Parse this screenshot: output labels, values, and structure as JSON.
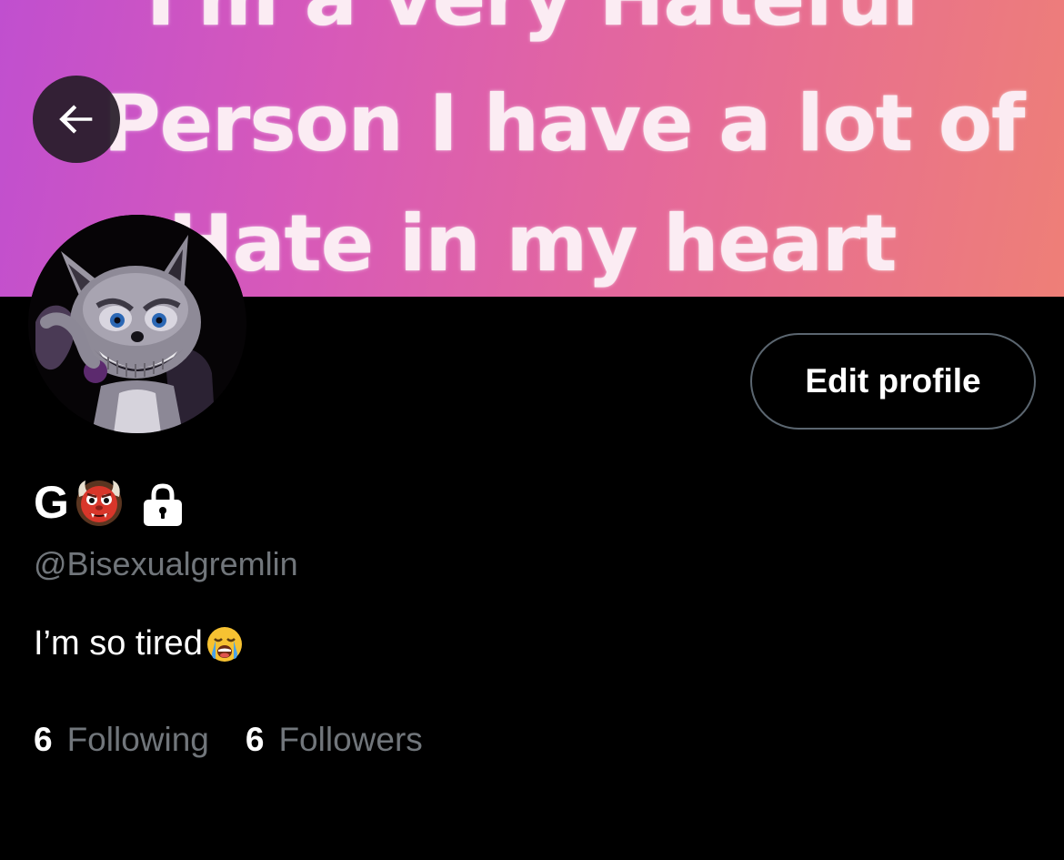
{
  "banner": {
    "lines": [
      "I'm a very Hateful",
      "Person I have a lot of",
      "Hate in my heart"
    ]
  },
  "header": {
    "back_icon": "arrow-left-icon"
  },
  "profile": {
    "display_name": "G",
    "name_emoji": "ogre-emoji",
    "protected_icon": "lock-icon",
    "handle": "@Bisexualgremlin",
    "bio": "I’m so tired",
    "bio_emoji": "loudly-crying-face-emoji",
    "edit_button_label": "Edit profile"
  },
  "stats": {
    "following_count": "6",
    "following_label": "Following",
    "followers_count": "6",
    "followers_label": "Followers"
  },
  "colors": {
    "background": "#000000",
    "secondary_text": "#71767b",
    "button_border": "#5b6670",
    "banner_start": "#c04fcf",
    "banner_end": "#ee7f77"
  }
}
